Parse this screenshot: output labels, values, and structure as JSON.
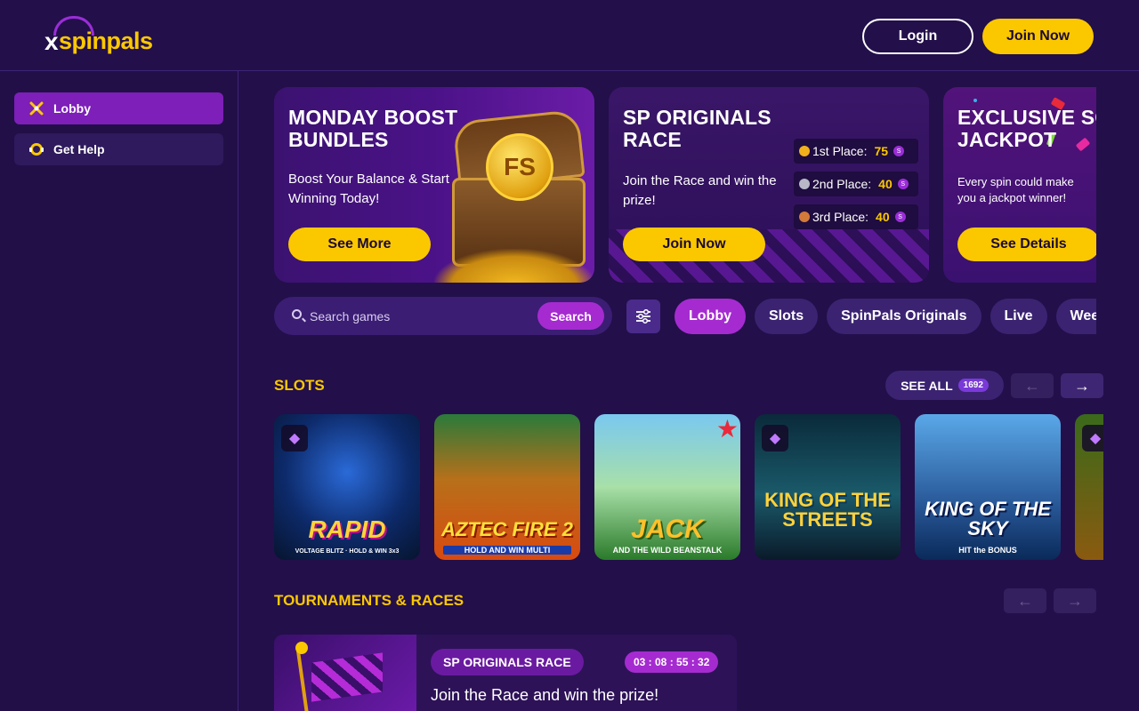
{
  "header": {
    "logo_text": "spinpals",
    "logo_x": "x",
    "login_label": "Login",
    "join_label": "Join Now",
    "colors": {
      "accent": "#fbc800",
      "purple": "#9b2dd8",
      "background": "#230f4a"
    }
  },
  "sidebar": {
    "items": [
      {
        "label": "Lobby",
        "icon": "lobby-icon",
        "active": true
      },
      {
        "label": "Get Help",
        "icon": "chat-help-icon",
        "active": false
      }
    ]
  },
  "banners": [
    {
      "title": "MONDAY BOOST BUNDLES",
      "description": "Boost Your Balance & Start Winning Today!",
      "button": "See More",
      "image_badge": "FS"
    },
    {
      "title": "SP ORIGINALS RACE",
      "description": "Join the Race and win the prize!",
      "button": "Join Now",
      "places": [
        {
          "label": "1st Place:",
          "amount": "75",
          "currency": "S"
        },
        {
          "label": "2nd Place:",
          "amount": "40",
          "currency": "S"
        },
        {
          "label": "3rd Place:",
          "amount": "40",
          "currency": "S"
        }
      ]
    },
    {
      "title": "EXCLUSIVE SC JACKPOT",
      "description": "Every spin could make you a jackpot winner!",
      "button": "See Details"
    }
  ],
  "search": {
    "placeholder": "Search games",
    "button": "Search"
  },
  "categories": [
    {
      "label": "Lobby",
      "active": true
    },
    {
      "label": "Slots",
      "active": false
    },
    {
      "label": "SpinPals Originals",
      "active": false
    },
    {
      "label": "Live",
      "active": false
    },
    {
      "label": "Wee",
      "active": false
    }
  ],
  "slots": {
    "title": "SLOTS",
    "see_all": "SEE ALL",
    "count": "1692",
    "games": [
      {
        "title": "RAPID",
        "subtitle": "VOLTAGE BLITZ · HOLD & WIN 3x3",
        "badge": "gem-icon"
      },
      {
        "title": "AZTEC FIRE 2",
        "subtitle": "HOLD AND WIN MULTI",
        "badge": ""
      },
      {
        "title": "JACK",
        "subtitle": "AND THE WILD BEANSTALK",
        "badge": "star-icon"
      },
      {
        "title": "KING OF THE STREETS",
        "subtitle": "",
        "badge": "gem-icon"
      },
      {
        "title": "KING OF THE SKY",
        "subtitle": "HIT the BONUS",
        "badge": ""
      }
    ]
  },
  "tournaments": {
    "title": "TOURNAMENTS & RACES",
    "card": {
      "tag": "SP ORIGINALS RACE",
      "timer": "03 : 08 : 55 : 32",
      "description": "Join the Race and win the prize!"
    }
  }
}
